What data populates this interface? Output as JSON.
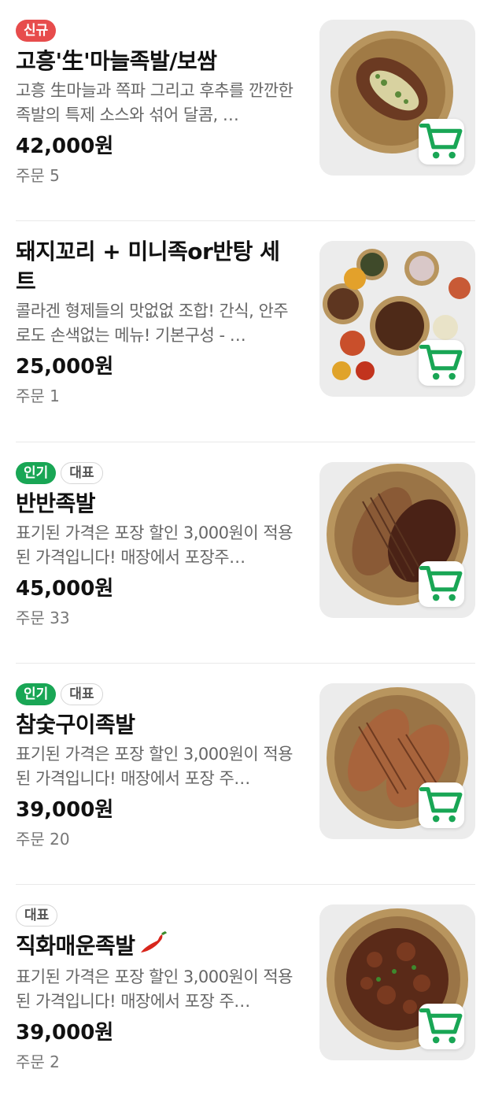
{
  "colors": {
    "accent": "#19a655",
    "new_badge": "#e74c4c",
    "cart_icon": "#19a655"
  },
  "items": [
    {
      "badges": [
        {
          "type": "new",
          "label": "신규"
        }
      ],
      "name": "고흥'生'마늘족발/보쌈",
      "desc": "고흥 生마늘과 쪽파 그리고 후추를 깐깐한족발의 특제 소스와 섞어 달콤, …",
      "price": "42,000원",
      "orders": "주문 5",
      "image_icon": "garlic-jokbal-image"
    },
    {
      "badges": [],
      "name": "돼지꼬리 + 미니족or반탕 세트",
      "desc": "콜라겐 형제들의 맛없없 조합! 간식, 안주로도 손색없는 메뉴! 기본구성 - …",
      "price": "25,000원",
      "orders": "주문 1",
      "image_icon": "pig-tail-set-image"
    },
    {
      "badges": [
        {
          "type": "popular",
          "label": "인기"
        },
        {
          "type": "signature",
          "label": "대표"
        }
      ],
      "name": "반반족발",
      "desc": "표기된 가격은 포장 할인 3,000원이 적용된 가격입니다! 매장에서 포장주…",
      "price": "45,000원",
      "orders": "주문 33",
      "image_icon": "half-half-jokbal-image"
    },
    {
      "badges": [
        {
          "type": "popular",
          "label": "인기"
        },
        {
          "type": "signature",
          "label": "대표"
        }
      ],
      "name": "참숯구이족발",
      "desc": "표기된 가격은 포장 할인 3,000원이 적용된 가격입니다! 매장에서 포장 주…",
      "price": "39,000원",
      "orders": "주문 20",
      "image_icon": "charcoal-jokbal-image"
    },
    {
      "badges": [
        {
          "type": "signature",
          "label": "대표"
        }
      ],
      "name": "직화매운족발",
      "desc": "표기된 가격은 포장 할인 3,000원이 적용된 가격입니다! 매장에서 포장 주…",
      "price": "39,000원",
      "orders": "주문 2",
      "image_icon": "spicy-jokbal-image",
      "spicy_icon": "chili-pepper-icon"
    }
  ]
}
